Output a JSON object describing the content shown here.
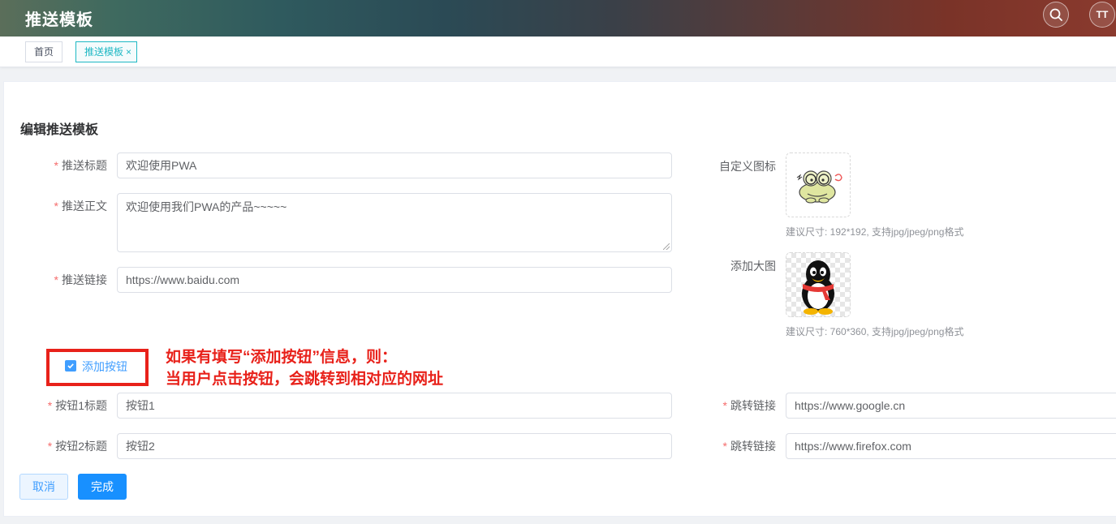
{
  "header": {
    "title": "推送模板",
    "font_toggle_label": "TT"
  },
  "tags": {
    "home": "首页",
    "active": "推送模板",
    "close_glyph": "×"
  },
  "form": {
    "title": "编辑推送模板",
    "required_mark": "*",
    "push_title": {
      "label": "推送标题",
      "value": "欢迎使用PWA"
    },
    "push_body": {
      "label": "推送正文",
      "value": "欢迎使用我们PWA的产品~~~~~"
    },
    "push_link": {
      "label": "推送链接",
      "value": "https://www.baidu.com"
    },
    "custom_icon": {
      "label": "自定义图标",
      "hint": "建议尺寸: 192*192, 支持jpg/jpeg/png格式"
    },
    "big_image": {
      "label": "添加大图",
      "hint": "建议尺寸: 760*360, 支持jpg/jpeg/png格式"
    },
    "add_button_checkbox": {
      "label": "添加按钮",
      "checked": true
    },
    "button1": {
      "label": "按钮1标题",
      "value": "按钮1",
      "link_label": "跳转链接",
      "link_value": "https://www.google.cn"
    },
    "button2": {
      "label": "按钮2标题",
      "value": "按钮2",
      "link_label": "跳转链接",
      "link_value": "https://www.firefox.com"
    },
    "cancel_label": "取消",
    "submit_label": "完成"
  },
  "annotation": {
    "line1": "如果有填写“添加按钮”信息，则：",
    "line2": "当用户点击按钮，会跳转到相对应的网址",
    "color": "#e8211a"
  },
  "colors": {
    "primary": "#1890ff",
    "accent_tag": "#1fb8c4",
    "required": "#f56c6c"
  }
}
